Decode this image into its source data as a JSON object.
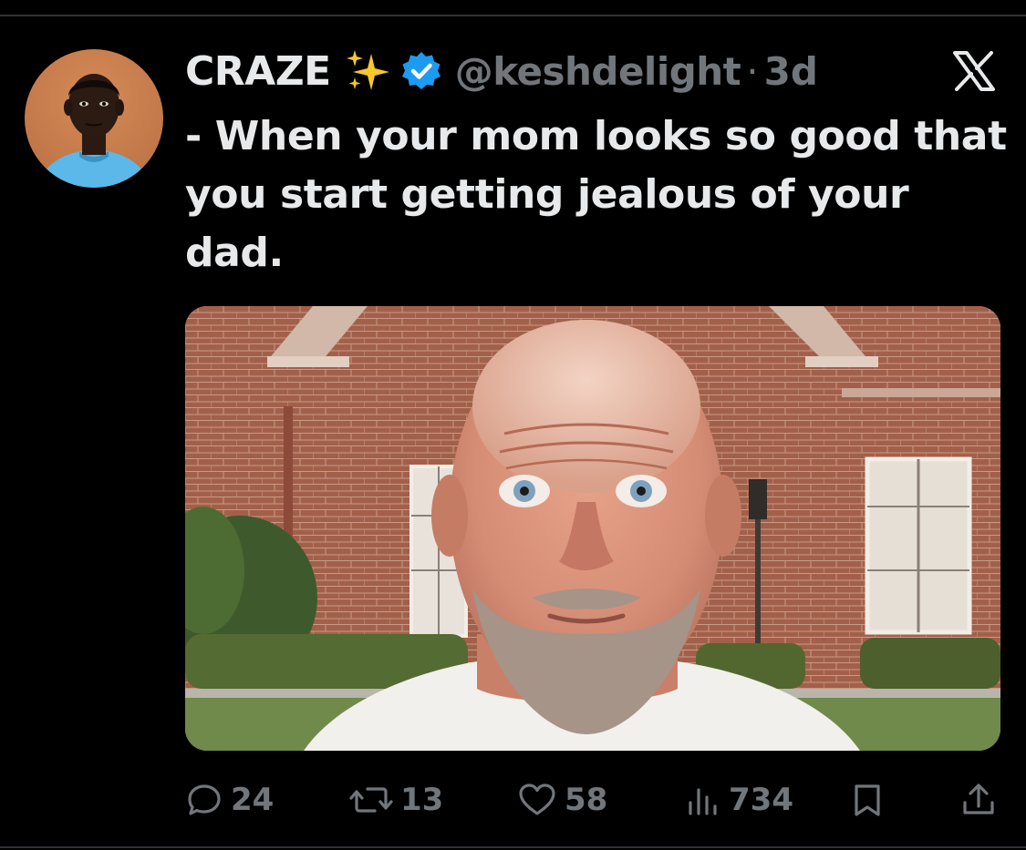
{
  "author": {
    "display_name": "CRAZE",
    "emoji": "sparkles-emoji",
    "verified": true,
    "handle": "@keshdelight",
    "separator": "·",
    "time": "3d"
  },
  "tweet": {
    "text": "- When your mom looks so good that\nyou start getting jealous of your\ndad."
  },
  "actions": {
    "replies": "24",
    "reposts": "13",
    "likes": "58",
    "views": "734"
  },
  "icons": {
    "reply": "reply-icon",
    "repost": "repost-icon",
    "like": "heart-icon",
    "views": "views-icon",
    "bookmark": "bookmark-icon",
    "share": "share-icon",
    "platform": "x-logo-icon"
  },
  "colors": {
    "background": "#000000",
    "primary_text": "#e7e9ea",
    "secondary_text": "#71767b",
    "verified_blue": "#1d9bf0",
    "sparkle_yellow": "#f7c82c"
  }
}
